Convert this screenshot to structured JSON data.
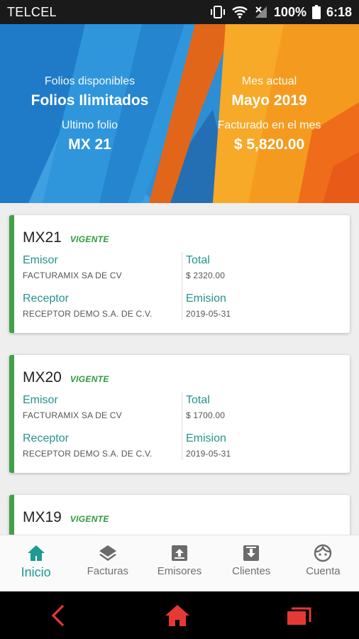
{
  "status_bar": {
    "carrier": "TELCEL",
    "battery": "100%",
    "time": "6:18"
  },
  "summary": {
    "left": {
      "label1": "Folios disponibles",
      "value1": "Folios Ilimitados",
      "label2": "Ultimo folio",
      "value2": "MX 21"
    },
    "right": {
      "label1": "Mes actual",
      "value1": "Mayo 2019",
      "label2": "Facturado en el mes",
      "value2": "$ 5,820.00"
    }
  },
  "invoices": [
    {
      "folio": "MX21",
      "status": "VIGENTE",
      "emisor_label": "Emisor",
      "emisor": "FACTURAMIX SA DE CV",
      "total_label": "Total",
      "total": "$ 2320.00",
      "receptor_label": "Receptor",
      "receptor": "RECEPTOR DEMO S.A. DE C.V.",
      "emision_label": "Emision",
      "emision": "2019-05-31"
    },
    {
      "folio": "MX20",
      "status": "VIGENTE",
      "emisor_label": "Emisor",
      "emisor": "FACTURAMIX SA DE CV",
      "total_label": "Total",
      "total": "$ 1700.00",
      "receptor_label": "Receptor",
      "receptor": "RECEPTOR DEMO S.A. DE C.V.",
      "emision_label": "Emision",
      "emision": "2019-05-31"
    },
    {
      "folio": "MX19",
      "status": "VIGENTE"
    }
  ],
  "nav": {
    "items": [
      {
        "label": "Inicio",
        "icon": "home-icon",
        "active": true
      },
      {
        "label": "Facturas",
        "icon": "layers-icon"
      },
      {
        "label": "Emisores",
        "icon": "upload-box-icon"
      },
      {
        "label": "Clientes",
        "icon": "download-box-icon"
      },
      {
        "label": "Cuenta",
        "icon": "face-icon"
      }
    ]
  },
  "colors": {
    "accent": "#1e9a91",
    "status_green": "#2e9b3c",
    "card_border": "#43a047",
    "hero_blue": "#2a8fd9",
    "hero_orange": "#f0951f",
    "system_nav_icons": "#e53935"
  }
}
